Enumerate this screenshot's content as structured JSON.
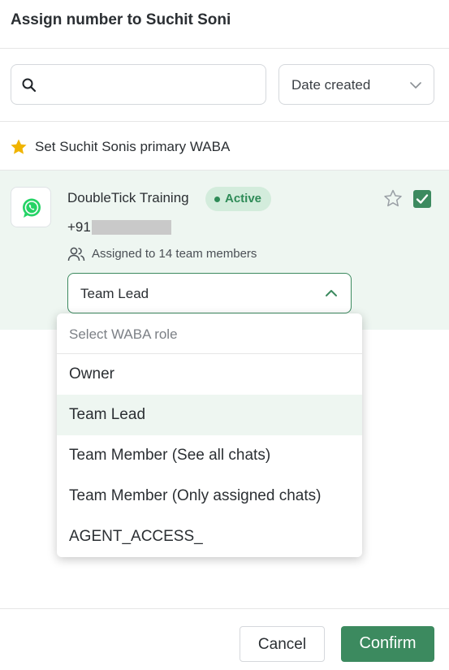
{
  "header": {
    "title": "Assign number to Suchit Soni"
  },
  "search": {
    "value": "",
    "placeholder": "",
    "icon": "search-icon"
  },
  "sort": {
    "label": "Date created",
    "icon": "chevron-down-icon"
  },
  "primary_waba": {
    "text": "Set Suchit Sonis primary WABA",
    "icon": "star-icon",
    "icon_color": "#f0b400"
  },
  "waba": {
    "name": "DoubleTick Training",
    "status": "Active",
    "status_color": "#2e8b57",
    "phone_prefix": "+91",
    "assigned_text": "Assigned to 14 team members",
    "selected_role": "Team Lead",
    "checked": true,
    "favorite": false
  },
  "role_dropdown": {
    "placeholder": "Select WABA role",
    "options": [
      "Owner",
      "Team Lead",
      "Team Member (See all chats)",
      "Team Member (Only assigned chats)",
      "AGENT_ACCESS_"
    ],
    "selected": "Team Lead"
  },
  "footer": {
    "cancel_label": "Cancel",
    "confirm_label": "Confirm"
  },
  "colors": {
    "accent": "#3c8a5f",
    "selected_bg": "#eef6f1"
  }
}
